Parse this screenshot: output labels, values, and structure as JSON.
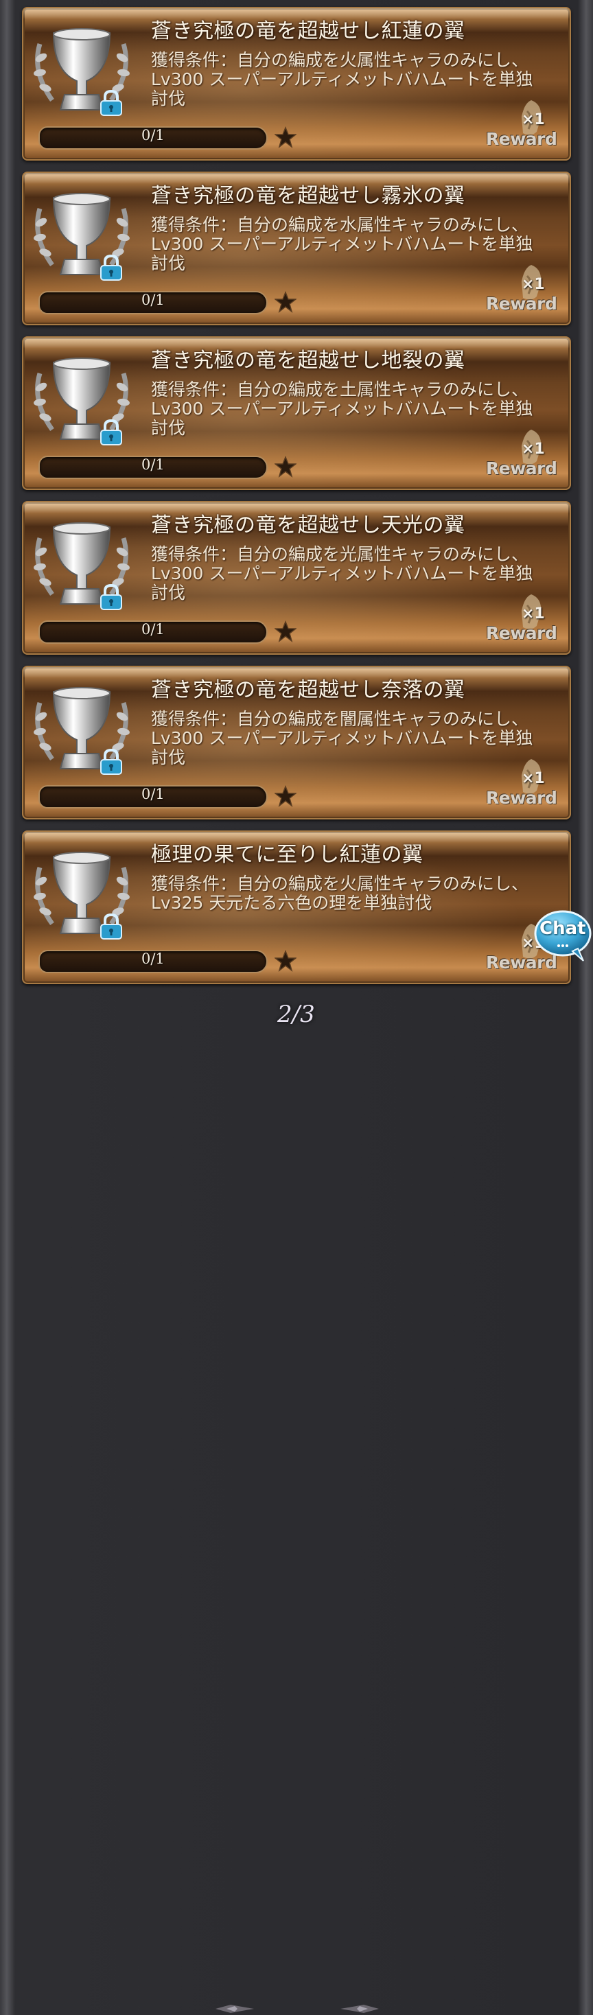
{
  "achievements": [
    {
      "title": "蒼き究極の竜を超越せし紅蓮の翼",
      "condition": "獲得条件：自分の編成を火属性キャラのみにし、\nLv300 スーパーアルティメットバハムートを単独\n討伐",
      "progress_text": "0/1",
      "progress": 0,
      "reward_count": "×1",
      "reward_label": "Reward"
    },
    {
      "title": "蒼き究極の竜を超越せし霧氷の翼",
      "condition": "獲得条件：自分の編成を水属性キャラのみにし、\nLv300 スーパーアルティメットバハムートを単独\n討伐",
      "progress_text": "0/1",
      "progress": 0,
      "reward_count": "×1",
      "reward_label": "Reward"
    },
    {
      "title": "蒼き究極の竜を超越せし地裂の翼",
      "condition": "獲得条件：自分の編成を土属性キャラのみにし、\nLv300 スーパーアルティメットバハムートを単独\n討伐",
      "progress_text": "0/1",
      "progress": 0,
      "reward_count": "×1",
      "reward_label": "Reward"
    },
    {
      "title": "蒼き究極の竜を超越せし天光の翼",
      "condition": "獲得条件：自分の編成を光属性キャラのみにし、\nLv300 スーパーアルティメットバハムートを単独\n討伐",
      "progress_text": "0/1",
      "progress": 0,
      "reward_count": "×1",
      "reward_label": "Reward"
    },
    {
      "title": "蒼き究極の竜を超越せし奈落の翼",
      "condition": "獲得条件：自分の編成を闇属性キャラのみにし、\nLv300 スーパーアルティメットバハムートを単独\n討伐",
      "progress_text": "0/1",
      "progress": 0,
      "reward_count": "×1",
      "reward_label": "Reward"
    },
    {
      "title": "極理の果てに至りし紅蓮の翼",
      "condition": "獲得条件：自分の編成を火属性キャラのみにし、\nLv325 天元たる六色の理を単独討伐",
      "progress_text": "0/1",
      "progress": 0,
      "reward_count": "×1",
      "reward_label": "Reward"
    }
  ],
  "pager": {
    "text": "2/3"
  },
  "chat": {
    "label": "Chat"
  },
  "colors": {
    "card_border": "#a77a44",
    "lock_blue": "#2a9ccc",
    "chat_blue": "#3aa6d6"
  },
  "icons": {
    "trophy": "silver-trophy-icon",
    "lock": "lock-icon",
    "star": "star-icon",
    "reward": "reward-item-icon"
  }
}
